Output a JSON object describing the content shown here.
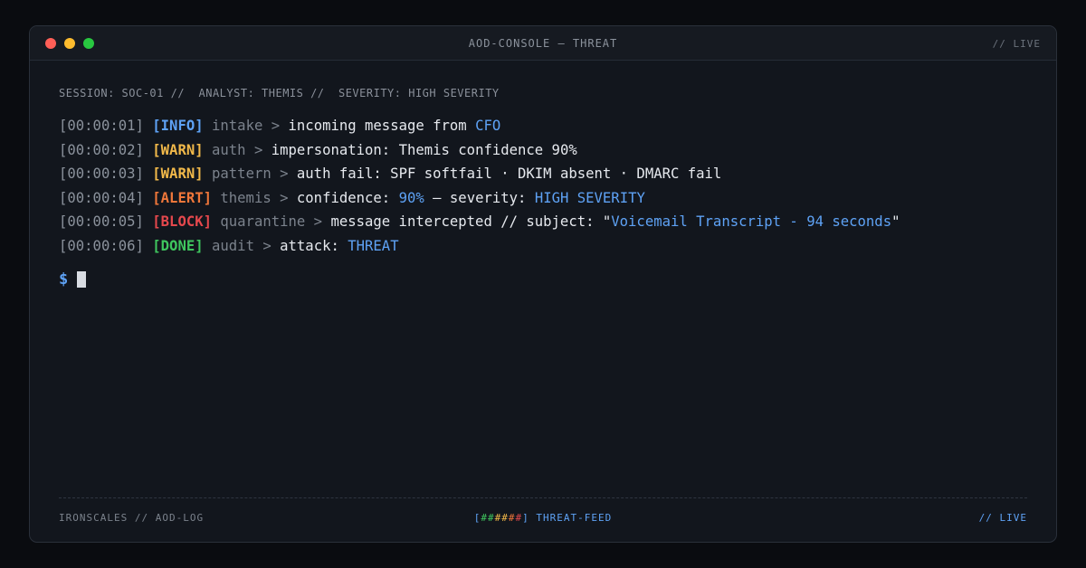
{
  "window": {
    "title": "AOD-CONSOLE — THREAT",
    "status": "// LIVE"
  },
  "session_line": "SESSION: SOC-01 //  ANALYST: THEMIS //  SEVERITY: HIGH SEVERITY",
  "log": [
    {
      "timestamp": "[00:00:01]",
      "tag": "[INFO]",
      "tag_color": "#5ea2f5",
      "source": "intake",
      "sep": " > ",
      "parts": [
        {
          "text": "incoming message from "
        },
        {
          "text": "CFO",
          "hl": true
        }
      ]
    },
    {
      "timestamp": "[00:00:02]",
      "tag": "[WARN]",
      "tag_color": "#f2b94a",
      "source": "auth",
      "sep": " > ",
      "parts": [
        {
          "text": "impersonation: Themis confidence 90%"
        }
      ]
    },
    {
      "timestamp": "[00:00:03]",
      "tag": "[WARN]",
      "tag_color": "#f2b94a",
      "source": "pattern",
      "sep": " > ",
      "parts": [
        {
          "text": "auth fail: SPF softfail · DKIM absent · DMARC fail"
        }
      ]
    },
    {
      "timestamp": "[00:00:04]",
      "tag": "[ALERT]",
      "tag_color": "#f0773a",
      "source": "themis",
      "sep": " > ",
      "parts": [
        {
          "text": "confidence: "
        },
        {
          "text": "90%",
          "hl": true
        },
        {
          "text": " — severity: "
        },
        {
          "text": "HIGH SEVERITY",
          "hl": true
        }
      ]
    },
    {
      "timestamp": "[00:00:05]",
      "tag": "[BLOCK]",
      "tag_color": "#e5484d",
      "source": "quarantine",
      "sep": " > ",
      "parts": [
        {
          "text": "message intercepted // subject: \""
        },
        {
          "text": "Voicemail Transcript - 94 seconds",
          "hl": true
        },
        {
          "text": "\""
        }
      ]
    },
    {
      "timestamp": "[00:00:06]",
      "tag": "[DONE]",
      "tag_color": "#3fc65e",
      "source": "audit",
      "sep": " > ",
      "parts": [
        {
          "text": "attack: "
        },
        {
          "text": "THREAT",
          "hl": true
        }
      ]
    }
  ],
  "prompt": {
    "symbol": "$"
  },
  "footer": {
    "left": "IRONSCALES // AOD-LOG",
    "bracket_open": "[",
    "bracket_close": "]",
    "meter": [
      {
        "char": "#",
        "color": "#3fc65e"
      },
      {
        "char": "#",
        "color": "#3fc65e"
      },
      {
        "char": "#",
        "color": "#f2b94a"
      },
      {
        "char": "#",
        "color": "#f2b94a"
      },
      {
        "char": "#",
        "color": "#f0773a"
      },
      {
        "char": "#",
        "color": "#e5484d"
      }
    ],
    "center_label": " THREAT-FEED",
    "right": "// LIVE"
  },
  "colors": {
    "accent": "#5ea2f5",
    "background": "#12161d"
  }
}
